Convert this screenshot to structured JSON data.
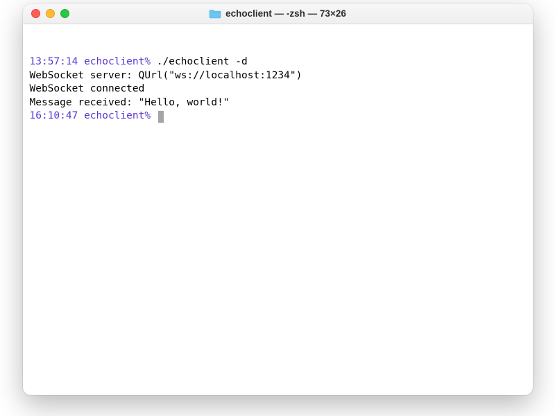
{
  "window": {
    "title": "echoclient — -zsh — 73×26",
    "folder_icon": "folder-icon"
  },
  "terminal": {
    "lines": [
      {
        "prompt": "13:57:14 echoclient%",
        "command": " ./echoclient -d"
      },
      {
        "output": "WebSocket server: QUrl(\"ws://localhost:1234\")"
      },
      {
        "output": "WebSocket connected"
      },
      {
        "output": "Message received: \"Hello, world!\""
      },
      {
        "prompt": "16:10:47 echoclient%",
        "command": " ",
        "cursor": true
      }
    ]
  },
  "colors": {
    "prompt": "#5836d1",
    "text": "#000000"
  }
}
